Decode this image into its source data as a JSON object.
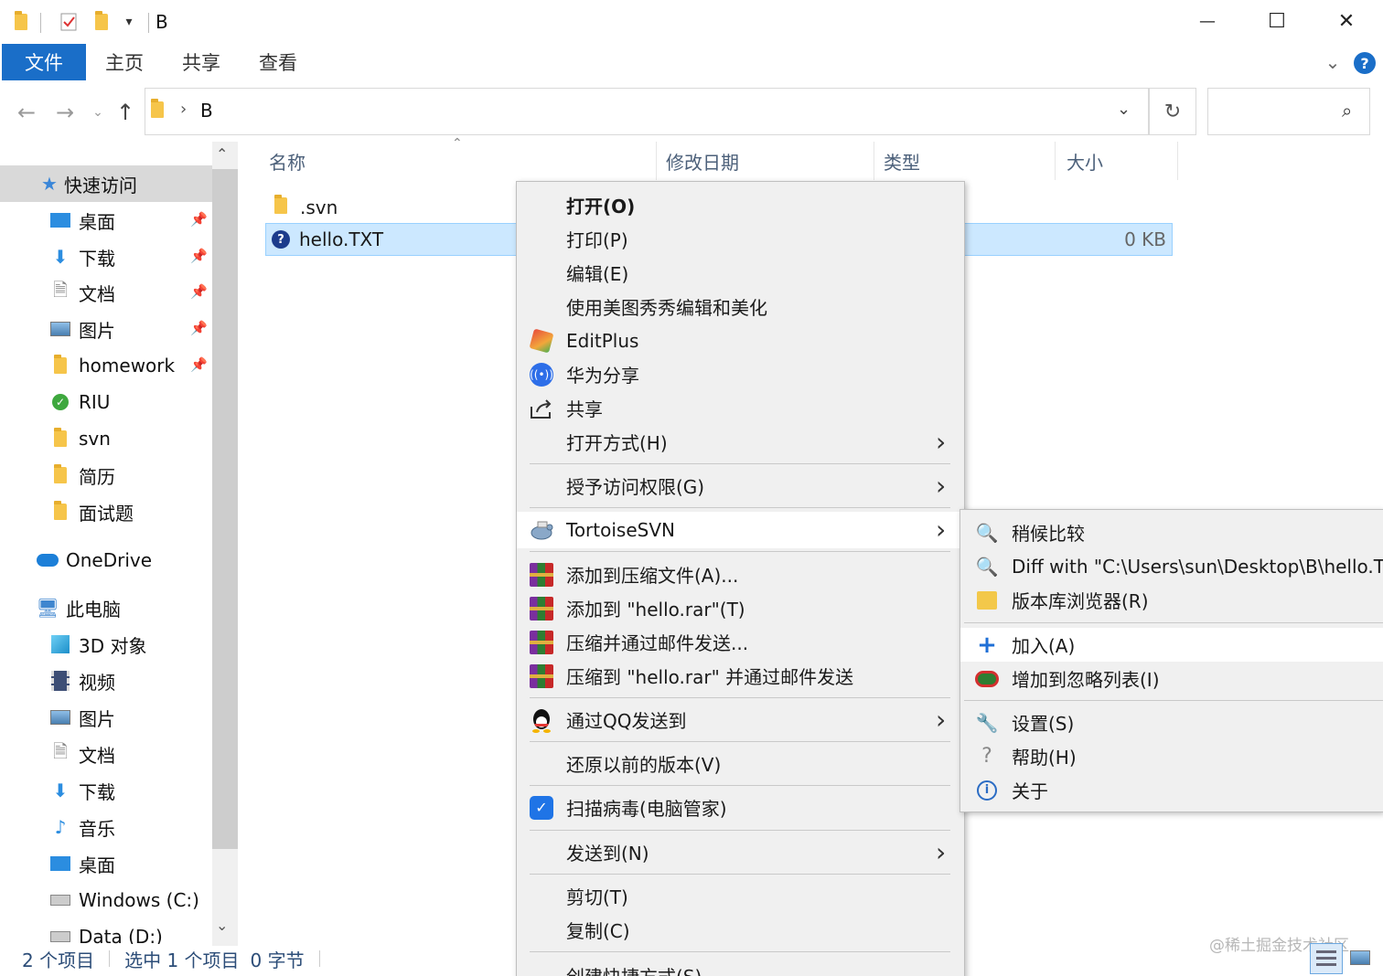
{
  "window": {
    "title": "B",
    "controls": {
      "minimize": "—",
      "maximize": "☐",
      "close": "✕"
    }
  },
  "ribbon": {
    "tabs": [
      {
        "label": "文件",
        "active": true
      },
      {
        "label": "主页",
        "active": false
      },
      {
        "label": "共享",
        "active": false
      },
      {
        "label": "查看",
        "active": false
      }
    ],
    "help_label": "?"
  },
  "address": {
    "path_segment": "B",
    "search_placeholder": ""
  },
  "nav": {
    "quick_access": "快速访问",
    "pinned": [
      {
        "label": "桌面",
        "icon": "desktop-icon"
      },
      {
        "label": "下载",
        "icon": "download-icon"
      },
      {
        "label": "文档",
        "icon": "documents-icon"
      },
      {
        "label": "图片",
        "icon": "pictures-icon"
      },
      {
        "label": "homework",
        "icon": "folder-icon"
      }
    ],
    "recent": [
      {
        "label": "RIU",
        "icon": "svn-folder-icon"
      },
      {
        "label": "svn",
        "icon": "folder-icon"
      },
      {
        "label": "简历",
        "icon": "folder-icon"
      },
      {
        "label": "面试题",
        "icon": "folder-icon"
      }
    ],
    "onedrive": "OneDrive",
    "this_pc": "此电脑",
    "pc_items": [
      {
        "label": "3D 对象",
        "icon": "3d-objects-icon"
      },
      {
        "label": "视频",
        "icon": "videos-icon"
      },
      {
        "label": "图片",
        "icon": "pictures-icon"
      },
      {
        "label": "文档",
        "icon": "documents-icon"
      },
      {
        "label": "下载",
        "icon": "download-icon"
      },
      {
        "label": "音乐",
        "icon": "music-icon"
      },
      {
        "label": "桌面",
        "icon": "desktop-icon"
      },
      {
        "label": "Windows (C:)",
        "icon": "drive-icon"
      },
      {
        "label": "Data (D:)",
        "icon": "drive-icon"
      }
    ]
  },
  "columns": {
    "name": "名称",
    "modified": "修改日期",
    "type": "类型",
    "size": "大小"
  },
  "files": [
    {
      "name": ".svn",
      "size": "",
      "selected": false
    },
    {
      "name": "hello.TXT",
      "size": "0 KB",
      "selected": true
    }
  ],
  "status": {
    "count": "2 个项目",
    "selection": "选中 1 个项目",
    "bytes": "0 字节"
  },
  "context_menu": {
    "groups": [
      [
        {
          "label": "打开(O)",
          "bold": true,
          "icon": ""
        },
        {
          "label": "打印(P)",
          "icon": ""
        },
        {
          "label": "编辑(E)",
          "icon": ""
        },
        {
          "label": "使用美图秀秀编辑和美化",
          "icon": ""
        },
        {
          "label": "EditPlus",
          "icon": "editplus-icon"
        },
        {
          "label": "华为分享",
          "icon": "huawei-share-icon"
        },
        {
          "label": "共享",
          "icon": "share-icon"
        },
        {
          "label": "打开方式(H)",
          "icon": "",
          "submenu": true
        }
      ],
      [
        {
          "label": "授予访问权限(G)",
          "icon": "",
          "submenu": true
        }
      ],
      [
        {
          "label": "TortoiseSVN",
          "icon": "tortoisesvn-icon",
          "submenu": true,
          "highlighted": true
        }
      ],
      [
        {
          "label": "添加到压缩文件(A)...",
          "icon": "winrar-icon"
        },
        {
          "label": "添加到 \"hello.rar\"(T)",
          "icon": "winrar-icon"
        },
        {
          "label": "压缩并通过邮件发送...",
          "icon": "winrar-icon"
        },
        {
          "label": "压缩到 \"hello.rar\" 并通过邮件发送",
          "icon": "winrar-icon"
        }
      ],
      [
        {
          "label": "通过QQ发送到",
          "icon": "qq-icon",
          "submenu": true
        }
      ],
      [
        {
          "label": "还原以前的版本(V)",
          "icon": ""
        }
      ],
      [
        {
          "label": "扫描病毒(电脑管家)",
          "icon": "pc-manager-icon"
        }
      ],
      [
        {
          "label": "发送到(N)",
          "icon": "",
          "submenu": true
        }
      ],
      [
        {
          "label": "剪切(T)",
          "icon": ""
        },
        {
          "label": "复制(C)",
          "icon": ""
        }
      ],
      [
        {
          "label": "创建快捷方式(S)",
          "icon": ""
        }
      ]
    ]
  },
  "svn_submenu": {
    "groups": [
      [
        {
          "label": "稍候比较",
          "icon": "magnifier-icon"
        },
        {
          "label": "Diff with \"C:\\Users\\sun\\Desktop\\B\\hello.TX",
          "icon": "magnifier-icon"
        },
        {
          "label": "版本库浏览器(R)",
          "icon": "repo-browser-icon"
        }
      ],
      [
        {
          "label": "加入(A)",
          "icon": "plus-icon",
          "highlighted": true
        },
        {
          "label": "增加到忽略列表(I)",
          "icon": "ignore-icon"
        }
      ],
      [
        {
          "label": "设置(S)",
          "icon": "wrench-icon"
        },
        {
          "label": "帮助(H)",
          "icon": "help-icon"
        },
        {
          "label": "关于",
          "icon": "info-icon"
        }
      ]
    ]
  },
  "watermark": "@稀土掘金技术社区",
  "colors": {
    "accent": "#1a6ec8",
    "selection": "#cce8ff",
    "menu_bg": "#f0f0f0",
    "menu_highlight": "#ffffff"
  }
}
